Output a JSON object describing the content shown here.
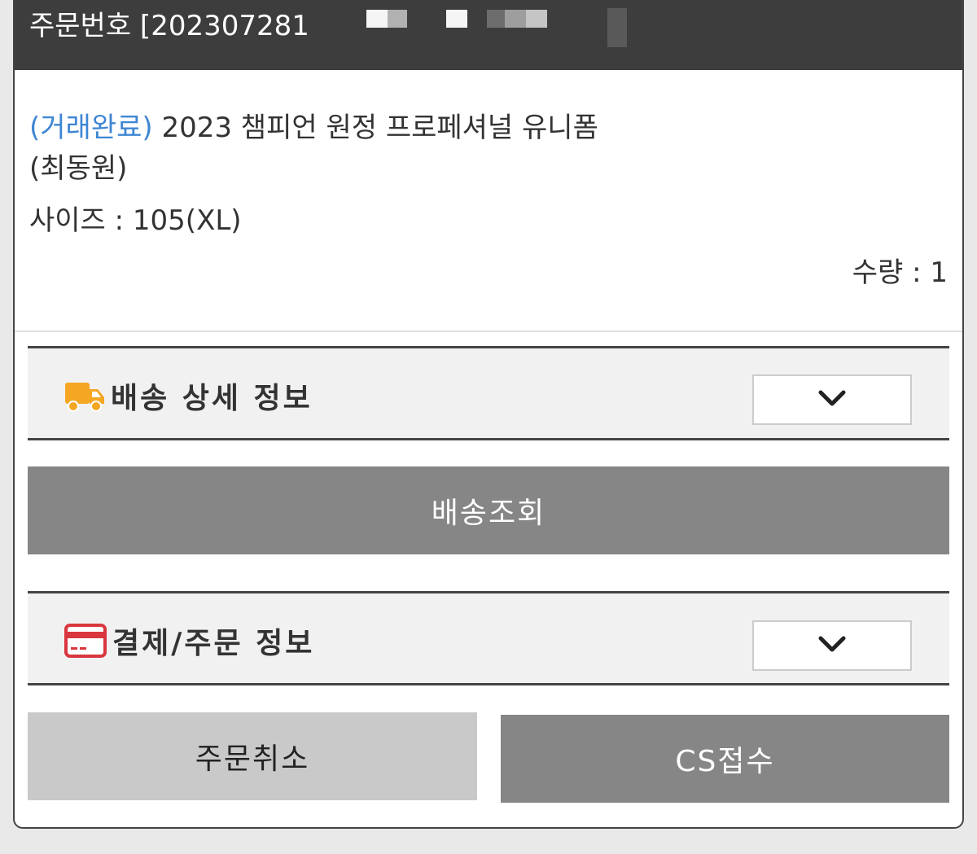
{
  "header": {
    "order_label": "주문번호 [202307281"
  },
  "product": {
    "status": "(거래완료)",
    "name": " 2023 챔피언 원정 프로페셔널 유니폼(최동원)",
    "size_label": "사이즈 : 105(XL)",
    "quantity_label": "수량 : 1"
  },
  "shipping_section": {
    "title": "배송 상세 정보",
    "icon": "truck-icon",
    "toggle_icon": "chevron-down-icon"
  },
  "track_button": {
    "label": "배송조회"
  },
  "payment_section": {
    "title": "결제/주문 정보",
    "icon": "credit-card-icon",
    "toggle_icon": "chevron-down-icon"
  },
  "actions": {
    "cancel_label": "주문취소",
    "cs_label": "CS접수"
  },
  "colors": {
    "header_bg": "#3d3d3d",
    "status_blue": "#3f86d3",
    "icon_orange": "#f5a623",
    "icon_red": "#d9363e",
    "button_dark": "#868686",
    "button_light": "#c9c9c9"
  }
}
